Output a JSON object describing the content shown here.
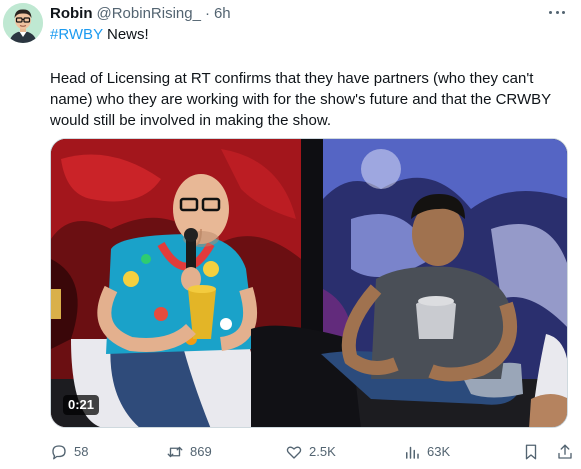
{
  "author": {
    "display_name": "Robin",
    "handle": "@RobinRising_",
    "separator": "·",
    "time": "6h"
  },
  "tweet": {
    "hashtag": "#RWBY",
    "tagline_rest": " News!",
    "text": "Head of Licensing at RT confirms that they have partners (who they can't name) who they are working with for the show's future and that the CRWBY would still be involved in making the show."
  },
  "media": {
    "duration": "0:21"
  },
  "actions": {
    "replies": "58",
    "retweets": "869",
    "likes": "2.5K",
    "views": "63K"
  },
  "icons": {
    "more": "more-horizontal-icon",
    "reply": "reply-icon",
    "retweet": "retweet-icon",
    "like": "heart-icon",
    "views": "views-bar-chart-icon",
    "bookmark": "bookmark-icon",
    "share": "share-icon"
  },
  "colors": {
    "link": "#1d9bf0",
    "secondary_text": "#536471",
    "primary_text": "#0f1419"
  }
}
